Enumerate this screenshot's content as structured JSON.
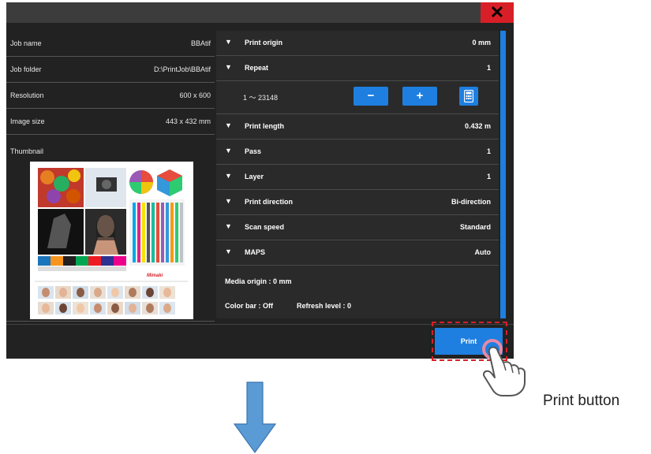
{
  "dialog": {
    "close_label": "✕",
    "info": [
      {
        "label": "Job name",
        "value": "BBAtif"
      },
      {
        "label": "Job folder",
        "value": "D:\\PrintJob\\BBAtif"
      },
      {
        "label": "Resolution",
        "value": "600 x 600"
      },
      {
        "label": "Image size",
        "value": "443 x 432 mm"
      }
    ],
    "thumbnail_label": "Thumbnail",
    "settings": [
      {
        "label": "Print origin",
        "value": "0 mm"
      },
      {
        "label": "Repeat",
        "value": "1"
      },
      {
        "label": "Print length",
        "value": "0.432 m"
      },
      {
        "label": "Pass",
        "value": "1"
      },
      {
        "label": "Layer",
        "value": "1"
      },
      {
        "label": "Print direction",
        "value": "Bi-direction"
      },
      {
        "label": "Scan speed",
        "value": "Standard"
      },
      {
        "label": "MAPS",
        "value": "Auto"
      }
    ],
    "repeat_range": "1 ～ 23148",
    "minus_label": "−",
    "plus_label": "+",
    "media_origin": "Media origin : 0 mm",
    "color_bar": "Color bar : Off",
    "refresh_level": "Refresh level : 0",
    "print_label": "Print",
    "brand_text": "Mimaki"
  },
  "callout": "Print button",
  "colors": {
    "accent": "#1e7fe0",
    "close": "#d81f27",
    "background": "#222222",
    "arrow": "#5b9bd5"
  },
  "icons": {
    "expand": "triangle-down-icon",
    "calculator": "calculator-icon",
    "close": "close-icon",
    "hand": "hand-pointer-icon",
    "arrow": "down-arrow-icon"
  }
}
